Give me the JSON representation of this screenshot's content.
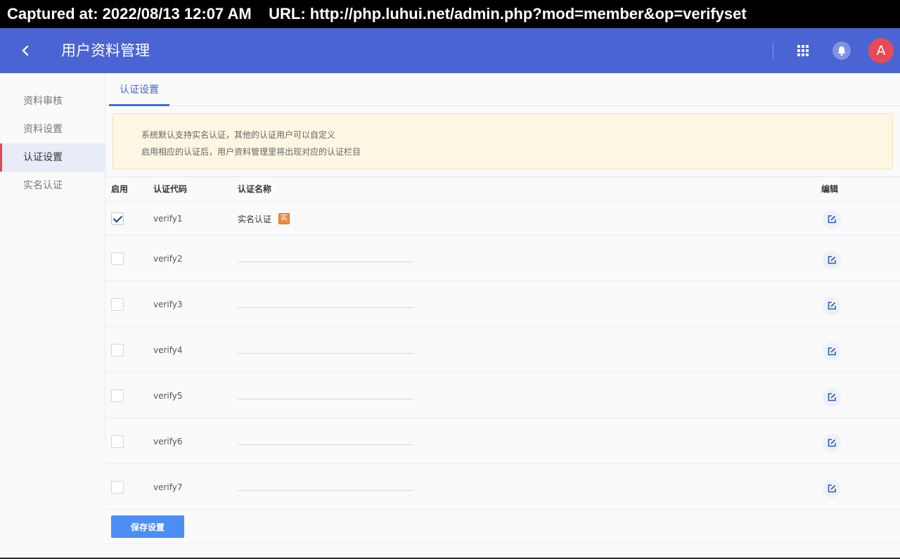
{
  "capture": {
    "text": "Captured at: 2022/08/13 12:07 AM    URL: http://php.luhui.net/admin.php?mod=member&op=verifyset"
  },
  "header": {
    "title": "用户资料管理",
    "avatar_letter": "A"
  },
  "sidebar": {
    "items": [
      {
        "label": "资料审核",
        "active": false
      },
      {
        "label": "资料设置",
        "active": false
      },
      {
        "label": "认证设置",
        "active": true
      },
      {
        "label": "实名认证",
        "active": false
      }
    ]
  },
  "tabs": [
    {
      "label": "认证设置",
      "active": true
    }
  ],
  "notice": {
    "line1": "系统默认支持实名认证，其他的认证用户可以自定义",
    "line2": "启用相应的认证后，用户资料管理里将出现对应的认证栏目"
  },
  "table": {
    "headers": {
      "enabled": "启用",
      "code": "认证代码",
      "name": "认证名称",
      "edit": "编辑"
    },
    "rows": [
      {
        "code": "verify1",
        "name": "实名认证",
        "badge": "实",
        "enabled": true
      },
      {
        "code": "verify2",
        "name": "",
        "enabled": false
      },
      {
        "code": "verify3",
        "name": "",
        "enabled": false
      },
      {
        "code": "verify4",
        "name": "",
        "enabled": false
      },
      {
        "code": "verify5",
        "name": "",
        "enabled": false
      },
      {
        "code": "verify6",
        "name": "",
        "enabled": false
      },
      {
        "code": "verify7",
        "name": "",
        "enabled": false
      }
    ]
  },
  "actions": {
    "save_label": "保存设置"
  },
  "colors": {
    "primary": "#4a64d3",
    "accent_red": "#e2484e",
    "save_button": "#4c8ef5",
    "notice_bg": "#fdf6e2"
  },
  "icons": [
    "chevron-left-icon",
    "grid-icon",
    "bell-icon",
    "edit-icon",
    "check-icon"
  ]
}
